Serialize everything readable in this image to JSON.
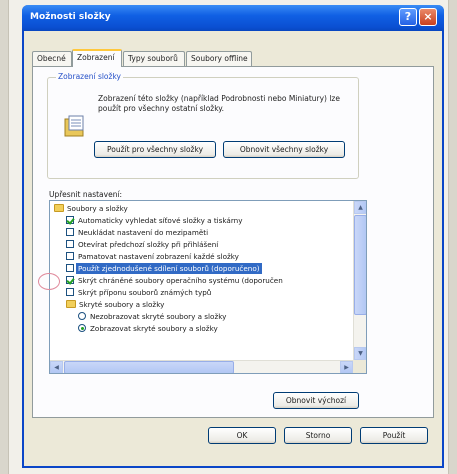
{
  "window": {
    "title": "Možnosti složky",
    "help_glyph": "?",
    "close_glyph": "×"
  },
  "tabs": [
    {
      "label": "Obecné",
      "active": false
    },
    {
      "label": "Zobrazení",
      "active": true
    },
    {
      "label": "Typy souborů",
      "active": false
    },
    {
      "label": "Soubory offline",
      "active": false
    }
  ],
  "folder_views": {
    "legend": "Zobrazení složky",
    "description": "Zobrazení této složky (například Podrobnosti nebo Miniatury) lze použít pro všechny ostatní složky.",
    "apply_label": "Použít pro všechny složky",
    "reset_label": "Obnovit všechny složky"
  },
  "advanced": {
    "label": "Upřesnit nastavení:",
    "items": [
      {
        "type": "folder",
        "label": "Soubory a složky",
        "indent": 0
      },
      {
        "type": "checkbox",
        "checked": true,
        "label": "Automaticky vyhledat síťové složky a tiskárny",
        "indent": 1
      },
      {
        "type": "checkbox",
        "checked": false,
        "label": "Neukládat nastavení do mezipaměti",
        "indent": 1
      },
      {
        "type": "checkbox",
        "checked": false,
        "label": "Otevírat předchozí složky při přihlášení",
        "indent": 1
      },
      {
        "type": "checkbox",
        "checked": false,
        "label": "Pamatovat nastavení zobrazení každé složky",
        "indent": 1
      },
      {
        "type": "checkbox",
        "checked": false,
        "label": "Použít zjednodušené sdílení souborů (doporučeno)",
        "indent": 1,
        "selected": true
      },
      {
        "type": "checkbox",
        "checked": true,
        "label": "Skrýt chráněné soubory operačního systému (doporučen",
        "indent": 1
      },
      {
        "type": "checkbox",
        "checked": false,
        "label": "Skrýt příponu souborů známých typů",
        "indent": 1
      },
      {
        "type": "folder",
        "label": "Skryté soubory a složky",
        "indent": 1
      },
      {
        "type": "radio",
        "checked": false,
        "label": "Nezobrazovat skryté soubory a složky",
        "indent": 2
      },
      {
        "type": "radio",
        "checked": true,
        "label": "Zobrazovat skryté soubory a složky",
        "indent": 2
      }
    ],
    "restore_label": "Obnovit výchozí"
  },
  "footer": {
    "ok_label": "OK",
    "cancel_label": "Storno",
    "apply_label": "Použít"
  },
  "colors": {
    "titlebar": "#0a4fd2",
    "selection": "#316ac5",
    "tab_accent": "#ffc83c"
  },
  "icons": {
    "scroll_up": "▲",
    "scroll_down": "▼",
    "scroll_left": "◀",
    "scroll_right": "▶"
  }
}
